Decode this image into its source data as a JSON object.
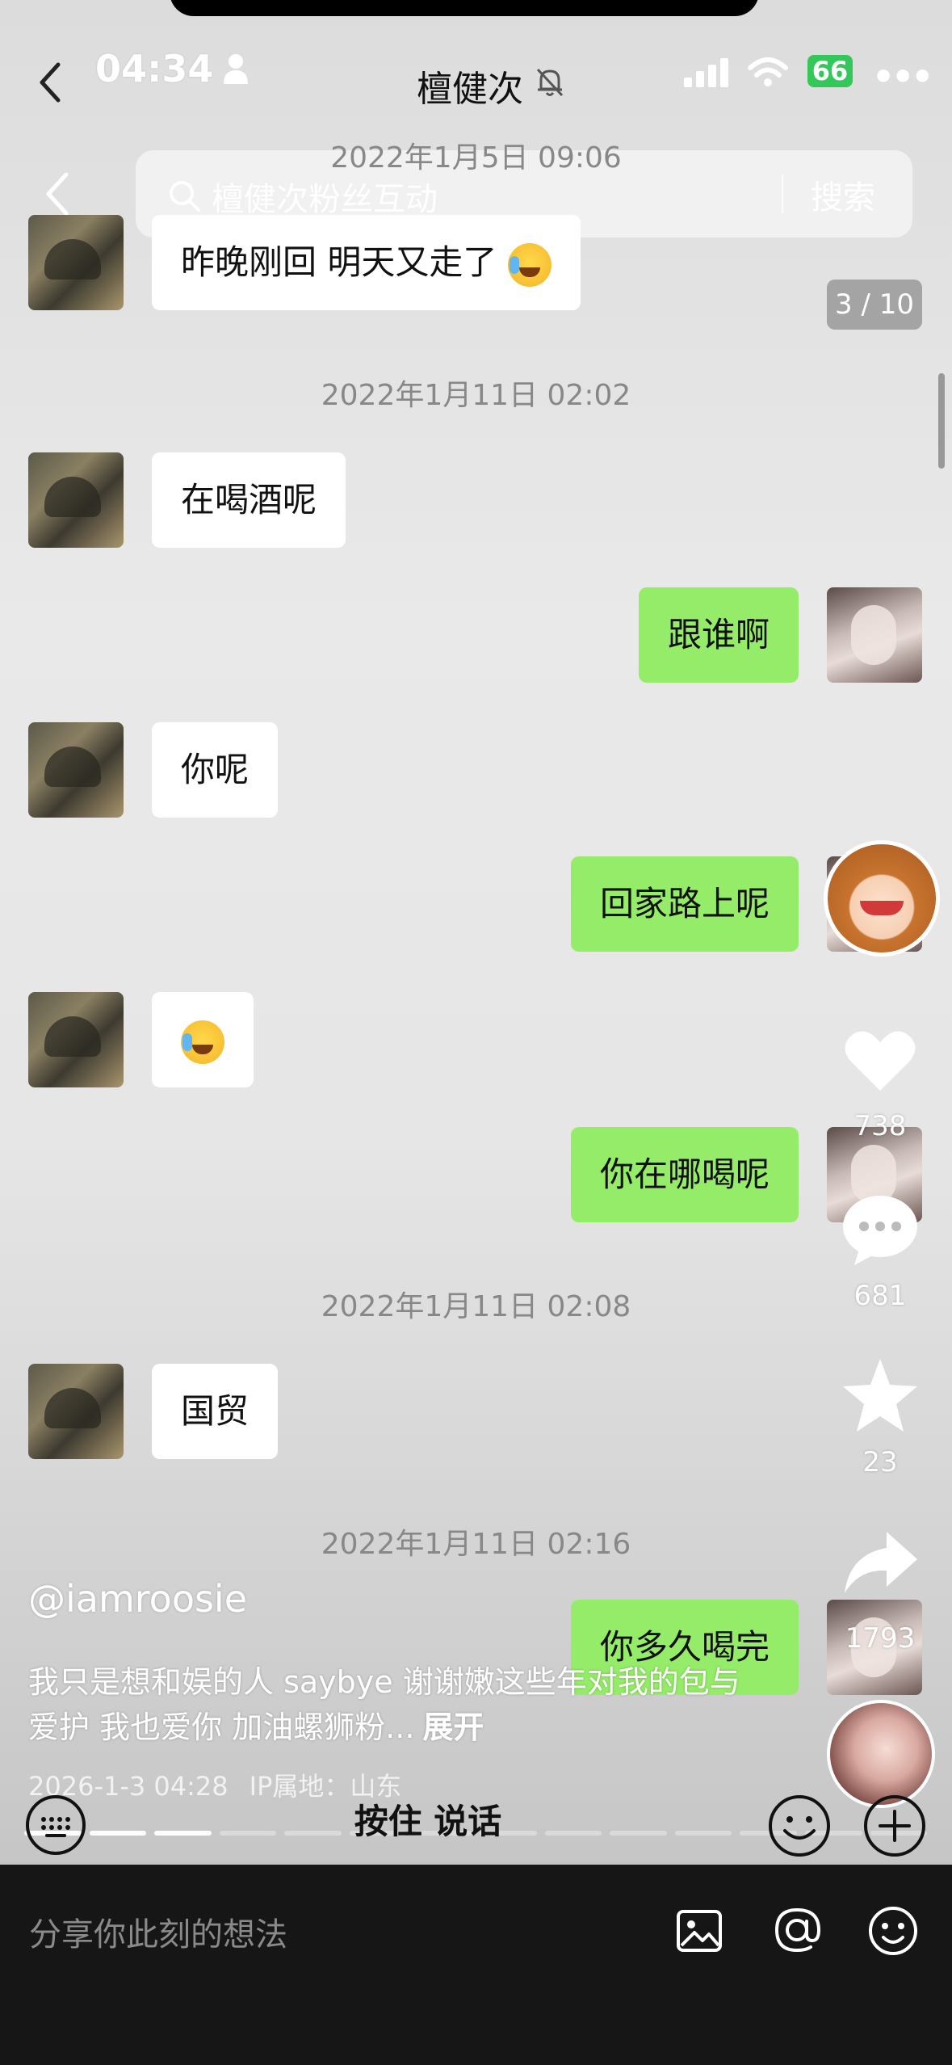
{
  "status": {
    "time": "04:34",
    "battery": "66"
  },
  "chat": {
    "title": "檀健次"
  },
  "search": {
    "placeholder": "檀健次粉丝互动",
    "button_label": "搜索",
    "page_counter": "3 / 10"
  },
  "messages": {
    "ts1": "2022年1月5日 09:06",
    "m1": "昨晚刚回 明天又走了",
    "ts2": "2022年1月11日 02:02",
    "m2": "在喝酒呢",
    "m3": "跟谁啊",
    "m4": "你呢",
    "m5": "回家路上呢",
    "m7": "你在哪喝呢",
    "ts3": "2022年1月11日 02:08",
    "m8": "国贸",
    "ts4": "2022年1月11日 02:16",
    "m9": "你多久喝完"
  },
  "actions": {
    "likes": "738",
    "comments": "681",
    "favorites": "23",
    "shares": "1793"
  },
  "post": {
    "author": "@iamroosie",
    "caption": "我只是想和娱的人 saybye 谢谢嫩这些年对我的包与爱护 我也爱你 加油螺狮粉...",
    "expand_label": "展开",
    "date": "2026-1-3 04:28",
    "ip_location": "IP属地：山东"
  },
  "voice": {
    "hold_label": "按住 说话"
  },
  "comment": {
    "placeholder": "分享你此刻的想法"
  },
  "colors": {
    "sent_bubble": "#95ec69",
    "received_bubble": "#ffffff",
    "bottom_bar": "#161616",
    "battery": "#34c759"
  },
  "icons": [
    "back-icon",
    "person-icon",
    "bell-muted-icon",
    "signal-icon",
    "wifi-icon",
    "search-icon",
    "heart-icon",
    "comment-icon",
    "star-icon",
    "share-icon",
    "keyboard-icon",
    "smiley-icon",
    "plus-icon",
    "image-icon",
    "at-icon",
    "emoji-icon"
  ],
  "story_progress": {
    "segments": 14,
    "active": 3
  }
}
